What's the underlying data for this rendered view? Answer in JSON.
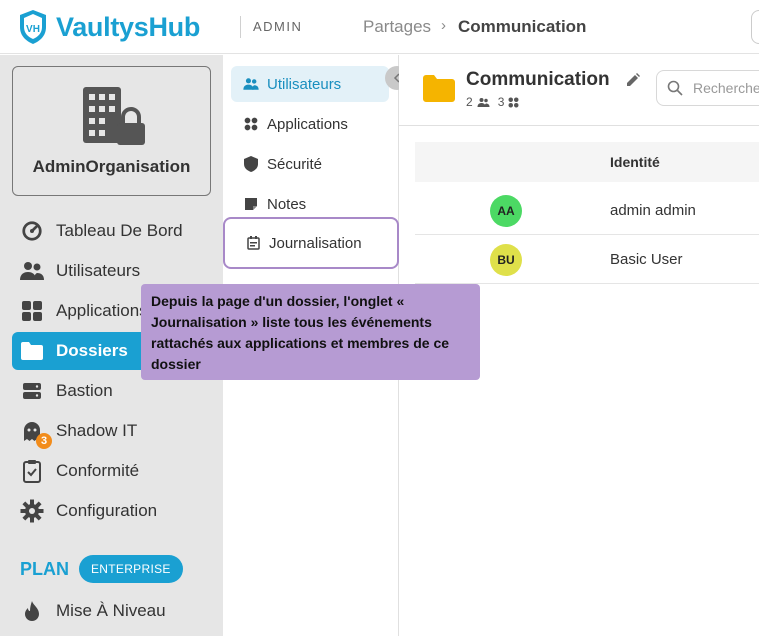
{
  "header": {
    "brand": "VaultysHub",
    "admin_label": "ADMIN",
    "breadcrumb_root": "Partages",
    "breadcrumb_separator": "›",
    "breadcrumb_current": "Communication",
    "brand_color": "#1aa0d2"
  },
  "sidebar": {
    "org_name": "AdminOrganisation",
    "items": [
      {
        "label": "Tableau De Bord",
        "icon": "gauge-icon"
      },
      {
        "label": "Utilisateurs",
        "icon": "users-icon"
      },
      {
        "label": "Applications",
        "icon": "apps-grid-icon"
      },
      {
        "label": "Dossiers",
        "icon": "folder-icon",
        "active": true
      },
      {
        "label": "Bastion",
        "icon": "server-icon"
      },
      {
        "label": "Shadow IT",
        "icon": "ghost-icon",
        "badge": "3"
      },
      {
        "label": "Conformité",
        "icon": "clipboard-check-icon"
      },
      {
        "label": "Configuration",
        "icon": "gear-icon"
      }
    ],
    "plan_label": "PLAN",
    "plan_tier": "ENTERPRISE",
    "upgrade_label": "Mise À Niveau"
  },
  "submenu": {
    "items": [
      {
        "label": "Utilisateurs",
        "icon": "users-icon",
        "active": true
      },
      {
        "label": "Applications",
        "icon": "apps-grid-icon"
      },
      {
        "label": "Sécurité",
        "icon": "shield-icon"
      },
      {
        "label": "Notes",
        "icon": "note-icon"
      },
      {
        "label": "Journalisation",
        "icon": "log-icon",
        "highlighted": true
      }
    ]
  },
  "main": {
    "folder_title": "Communication",
    "users_count": "2",
    "apps_count": "3",
    "search_placeholder": "Rechercher",
    "table": {
      "column_identity": "Identité",
      "rows": [
        {
          "initials": "AA",
          "name": "admin admin",
          "avatar_color": "#4cd964"
        },
        {
          "initials": "BU",
          "name": "Basic User",
          "avatar_color": "#dfe04a"
        }
      ]
    }
  },
  "tooltip": {
    "text": "Depuis la page d'un dossier, l'onglet « Journalisation » liste tous les événements rattachés aux applications et membres de ce dossier",
    "color": "#b69bd3"
  }
}
